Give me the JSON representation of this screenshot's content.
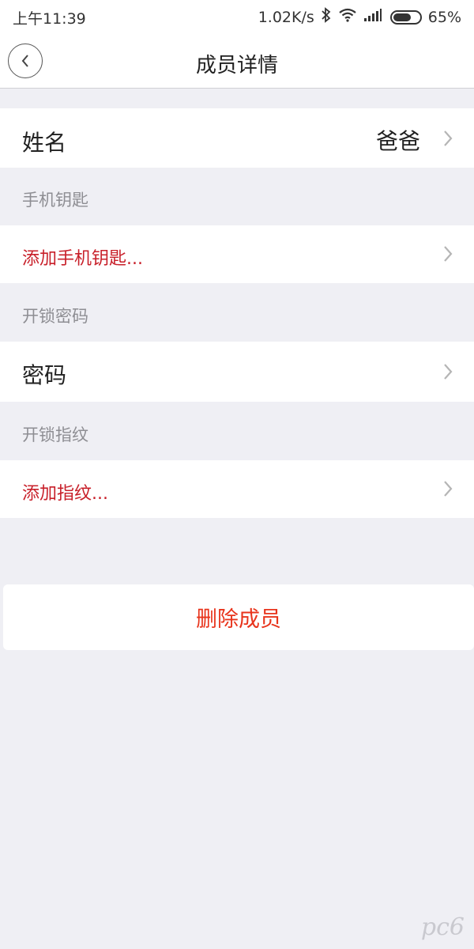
{
  "status_bar": {
    "time": "上午11:39",
    "speed": "1.02K/s",
    "battery": "65%",
    "battery_level": 0.65
  },
  "nav": {
    "title": "成员详情"
  },
  "name_row": {
    "label": "姓名",
    "value": "爸爸"
  },
  "phone_key": {
    "header": "手机钥匙",
    "action": "添加手机钥匙..."
  },
  "unlock_password": {
    "header": "开锁密码",
    "label": "密码"
  },
  "unlock_fingerprint": {
    "header": "开锁指纹",
    "action": "添加指纹..."
  },
  "delete_member": {
    "label": "删除成员"
  },
  "watermark": {
    "text": "pc6"
  },
  "colors": {
    "accent_red": "#c8202a",
    "delete_red": "#e8341c",
    "background": "#efeff4"
  }
}
